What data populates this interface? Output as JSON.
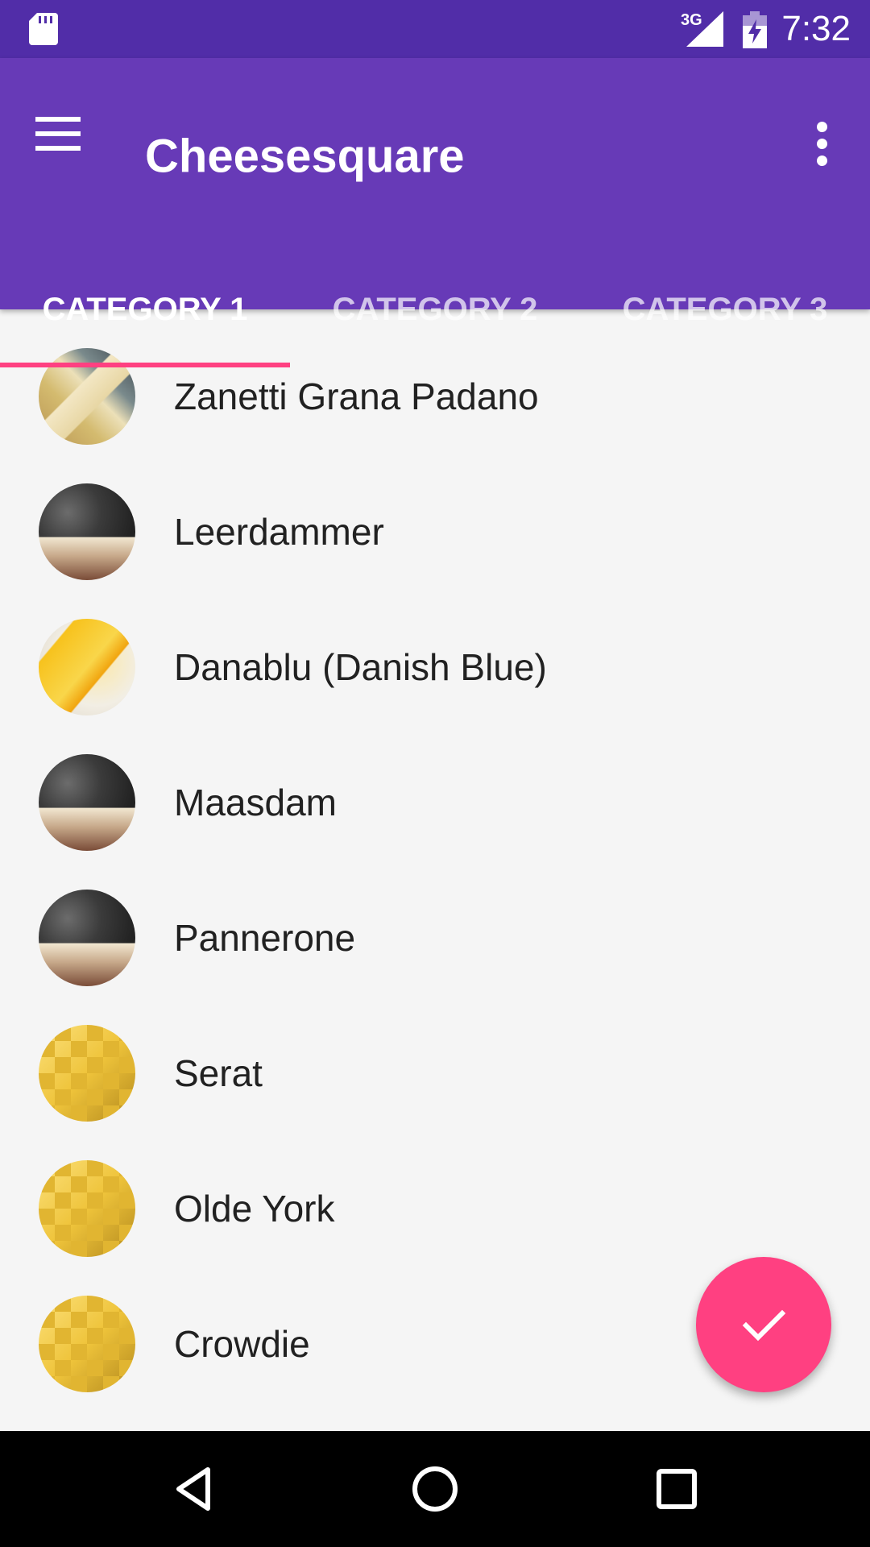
{
  "status_bar": {
    "network_label": "3G",
    "time": "7:32",
    "icons": [
      "sd-card-icon",
      "cell-signal-icon",
      "battery-charging-icon"
    ]
  },
  "app_bar": {
    "title": "Cheesesquare",
    "menu_icon": "hamburger-menu-icon",
    "overflow_icon": "more-vert-icon"
  },
  "tabs": [
    {
      "label": "CATEGORY 1",
      "selected": true
    },
    {
      "label": "CATEGORY 2",
      "selected": false
    },
    {
      "label": "CATEGORY 3",
      "selected": false
    }
  ],
  "cheese_list": {
    "items": [
      {
        "name": "Zanetti Grana Padano",
        "avatar": "cheese-wedges"
      },
      {
        "name": "Leerdammer",
        "avatar": "cheese-wheels"
      },
      {
        "name": "Danablu (Danish Blue)",
        "avatar": "yellow-cheese"
      },
      {
        "name": "Maasdam",
        "avatar": "cheese-wheels"
      },
      {
        "name": "Pannerone",
        "avatar": "cheese-wheels"
      },
      {
        "name": "Serat",
        "avatar": "cheese-cubes"
      },
      {
        "name": "Olde York",
        "avatar": "cheese-cubes"
      },
      {
        "name": "Crowdie",
        "avatar": "cheese-cubes"
      }
    ]
  },
  "fab": {
    "icon": "check-icon"
  },
  "nav_bar": {
    "buttons": [
      "back-icon",
      "home-icon",
      "recents-icon"
    ]
  },
  "colors": {
    "status_bar": "#512da8",
    "primary": "#673ab7",
    "accent": "#ff4081",
    "background": "#f5f5f5",
    "text_primary": "#212121"
  }
}
